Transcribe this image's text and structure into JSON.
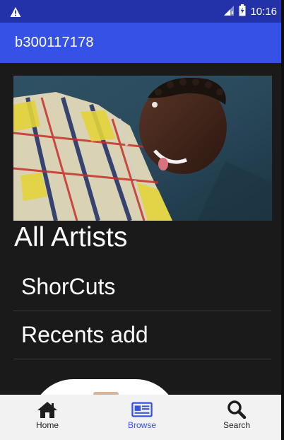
{
  "status_bar": {
    "time": "10:16",
    "warning_icon": "warning-triangle-icon",
    "signal_icon": "cell-signal-icon",
    "battery_icon": "battery-charging-icon"
  },
  "app_bar": {
    "title": "b300117178"
  },
  "main": {
    "hero_image_alt": "artist-photo",
    "section_heading": "All Artists",
    "list_items": [
      {
        "label": "ShorCuts"
      },
      {
        "label": "Recents add"
      }
    ]
  },
  "bottom_nav": {
    "items": [
      {
        "label": "Home",
        "icon": "home-icon",
        "active": false
      },
      {
        "label": "Browse",
        "icon": "browse-icon",
        "active": true
      },
      {
        "label": "Search",
        "icon": "search-icon",
        "active": false
      }
    ]
  },
  "colors": {
    "status_bar": "#2332a8",
    "app_bar": "#3551e6",
    "background": "#1a1a1a",
    "nav_background": "#f2f2f2",
    "active_accent": "#3551e6"
  }
}
